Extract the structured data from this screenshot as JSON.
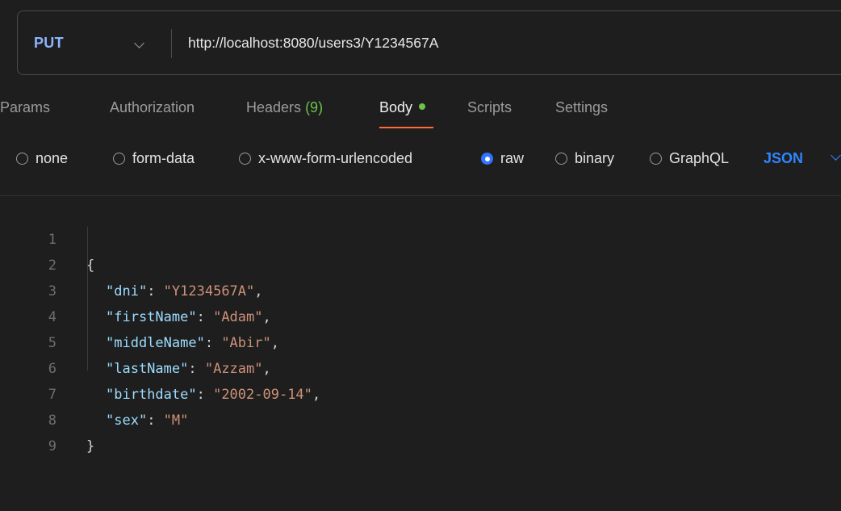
{
  "request": {
    "method": "PUT",
    "url": "http://localhost:8080/users3/Y1234567A"
  },
  "tabs": [
    {
      "label": "Params"
    },
    {
      "label": "Authorization"
    },
    {
      "label": "Headers",
      "count": "(9)"
    },
    {
      "label": "Body",
      "active": true
    },
    {
      "label": "Scripts"
    },
    {
      "label": "Settings"
    }
  ],
  "body_types": [
    {
      "label": "none",
      "selected": false
    },
    {
      "label": "form-data",
      "selected": false
    },
    {
      "label": "x-www-form-urlencoded",
      "selected": false
    },
    {
      "label": "raw",
      "selected": true
    },
    {
      "label": "binary",
      "selected": false
    },
    {
      "label": "GraphQL",
      "selected": false
    }
  ],
  "format": "JSON",
  "editor": {
    "lines": [
      {
        "n": "1",
        "open": "{"
      },
      {
        "n": "2",
        "key": "\"dni\"",
        "sep": ": ",
        "value": "\"Y1234567A\"",
        "tail": ","
      },
      {
        "n": "3",
        "key": "\"firstName\"",
        "sep": ": ",
        "value": "\"Adam\"",
        "tail": ","
      },
      {
        "n": "4",
        "key": "\"middleName\"",
        "sep": ": ",
        "value": "\"Abir\"",
        "tail": ","
      },
      {
        "n": "5",
        "key": "\"lastName\"",
        "sep": ": ",
        "value": "\"Azzam\"",
        "tail": ","
      },
      {
        "n": "6",
        "key": "\"birthdate\"",
        "sep": ": ",
        "value": "\"2002-09-14\"",
        "tail": ","
      },
      {
        "n": "7",
        "key": "\"sex\"",
        "sep": ": ",
        "value": "\"M\"",
        "tail": ""
      },
      {
        "n": "8",
        "open": "}"
      },
      {
        "n": "9",
        "open": ""
      }
    ]
  },
  "colors": {
    "method": "#8fb3ff",
    "active_underline": "#ff6c37",
    "status_dot": "#6cc24a",
    "radio_selected": "#2f73ff",
    "json_key": "#9cdcfe",
    "json_string": "#ce9178"
  }
}
